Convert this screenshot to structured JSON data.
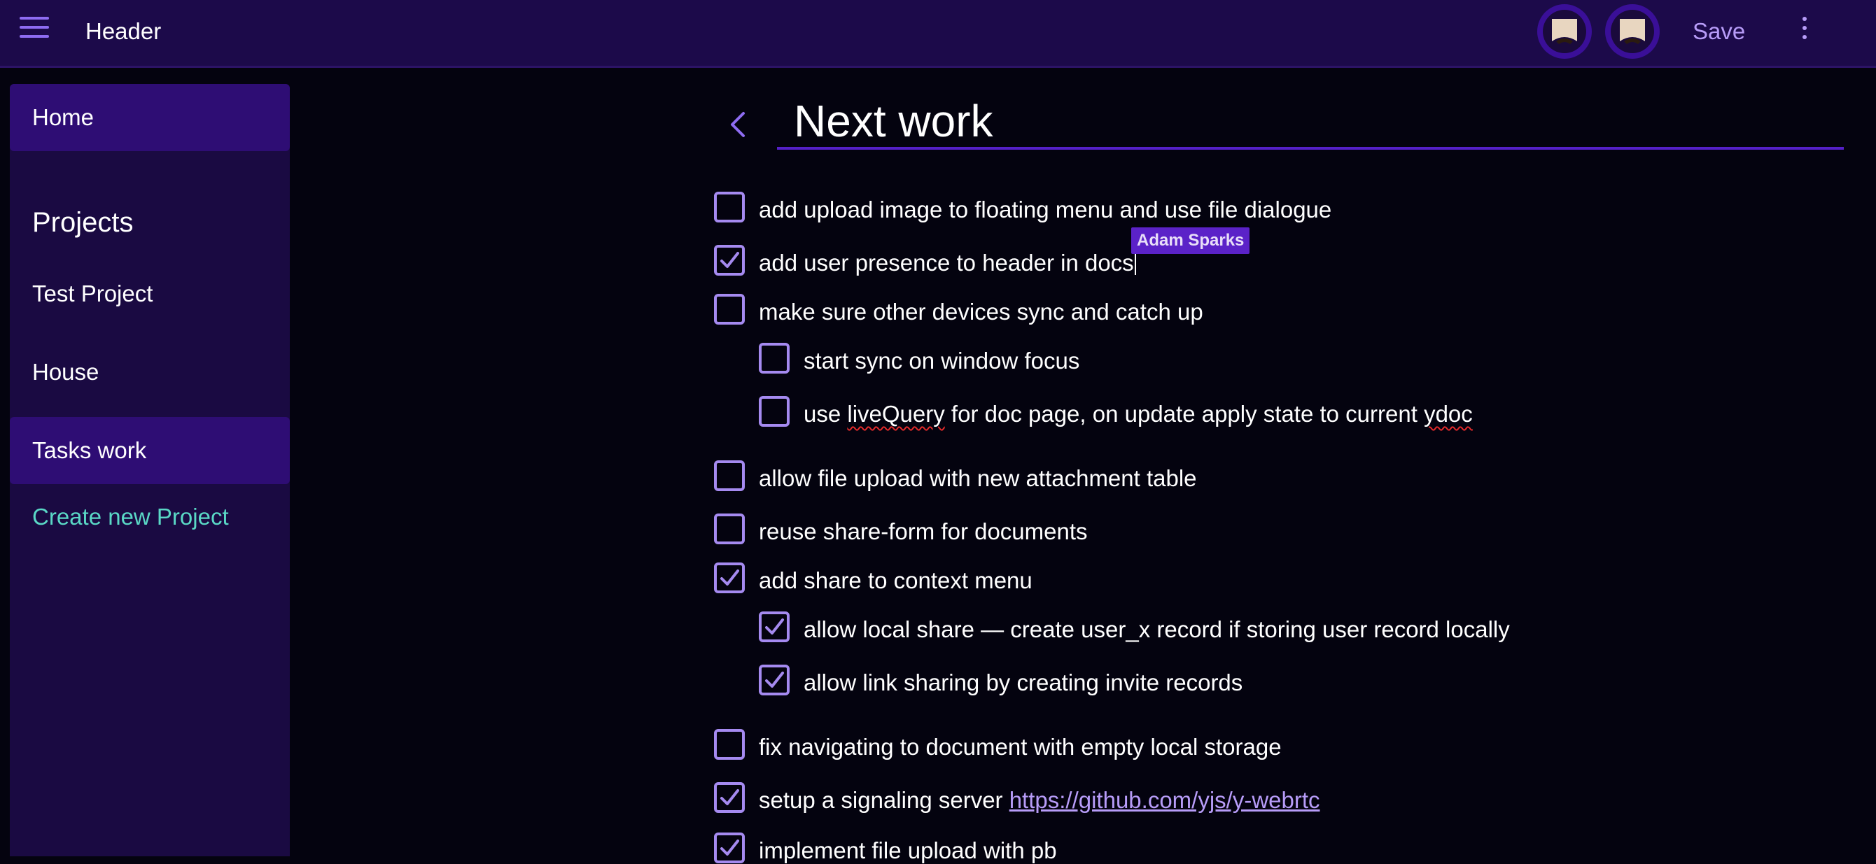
{
  "header": {
    "title": "Header",
    "save_label": "Save",
    "icons": {
      "menu": "hamburger-menu-icon",
      "more": "more-vertical-icon",
      "avatar": "user-avatar-icon"
    }
  },
  "sidebar": {
    "home_label": "Home",
    "projects_heading": "Projects",
    "projects": [
      "Test Project",
      "House",
      "Tasks work"
    ],
    "create_label": "Create new Project"
  },
  "document": {
    "title": "Next work",
    "presence_label": "Adam Sparks",
    "link_url": "https://github.com/yjs/y-webrtc",
    "tasks": [
      {
        "text": "add upload image to floating menu and use file dialogue",
        "checked": false,
        "indent": 0
      },
      {
        "text": "add user presence to header in docs",
        "checked": true,
        "indent": 0
      },
      {
        "text": "make sure other devices sync and catch up",
        "checked": false,
        "indent": 0
      },
      {
        "text": "start sync on window focus",
        "checked": false,
        "indent": 1
      },
      {
        "text_before": "use ",
        "text_squiggle_1": "liveQuery",
        "text_middle": " for doc page, on update apply state to current ",
        "text_squiggle_2": "ydoc",
        "checked": false,
        "indent": 1
      },
      {
        "text": "allow file upload with new attachment table",
        "checked": false,
        "indent": 0
      },
      {
        "text": "reuse share-form for documents",
        "checked": false,
        "indent": 0
      },
      {
        "text": "add share to context menu",
        "checked": true,
        "indent": 0
      },
      {
        "text": "allow local share — create user_x record if storing user record locally",
        "checked": true,
        "indent": 1
      },
      {
        "text": "allow link sharing by creating invite records",
        "checked": true,
        "indent": 1
      },
      {
        "text": "fix navigating to document with empty local storage",
        "checked": false,
        "indent": 0
      },
      {
        "text": "setup a signaling server ",
        "checked": true,
        "indent": 0
      },
      {
        "text": "implement file upload with pb",
        "checked": true,
        "indent": 0
      }
    ]
  },
  "colors": {
    "header_bg": "#1c0a4a",
    "sidebar_bg": "#1a0a42",
    "sidebar_active": "#2e0d74",
    "accent": "#8e6cf2",
    "checkbox": "#a58af0",
    "link": "#b79cf8",
    "create_link": "#5ad8c6",
    "page_bg": "#04030f"
  }
}
